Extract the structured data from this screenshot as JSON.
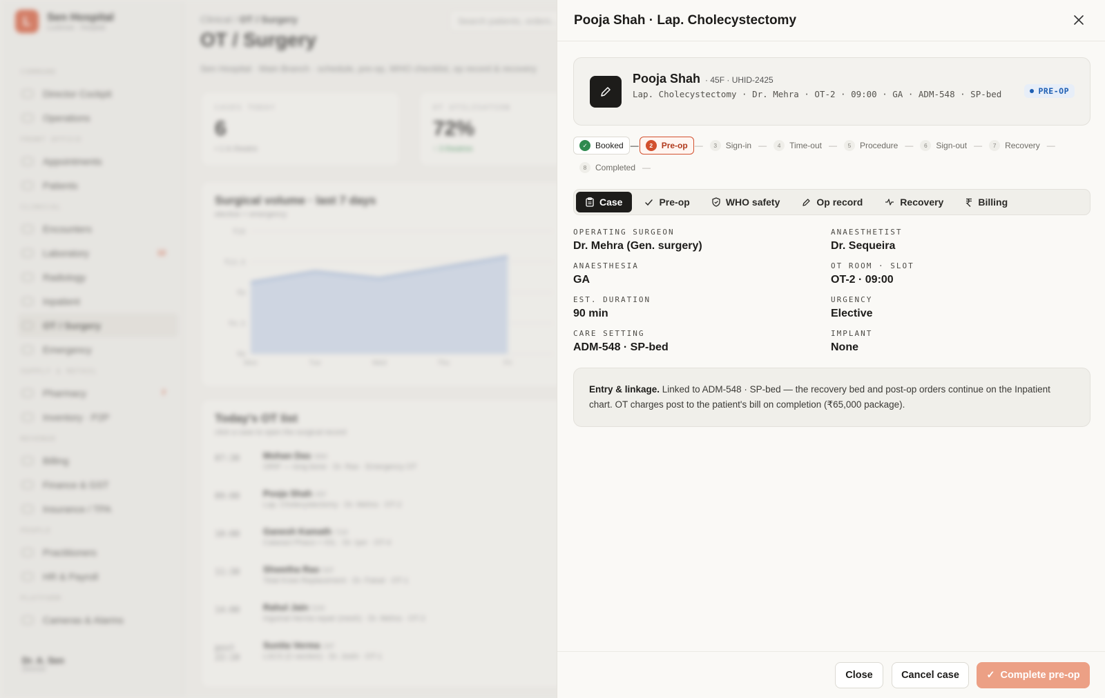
{
  "background": {
    "brand": {
      "name": "Sen Hospital",
      "sub": "Lucknow · Hospital"
    },
    "nav": [
      {
        "section": "COMMAND",
        "items": [
          {
            "label": "Director Cockpit"
          },
          {
            "label": "Operations"
          }
        ]
      },
      {
        "section": "FRONT OFFICE",
        "items": [
          {
            "label": "Appointments"
          },
          {
            "label": "Patients"
          }
        ]
      },
      {
        "section": "CLINICAL",
        "items": [
          {
            "label": "Encounters"
          },
          {
            "label": "Laboratory",
            "badge": "12"
          },
          {
            "label": "Radiology"
          },
          {
            "label": "Inpatient"
          },
          {
            "label": "OT / Surgery",
            "active": true
          },
          {
            "label": "Emergency"
          }
        ]
      },
      {
        "section": "SUPPLY & RETAIL",
        "items": [
          {
            "label": "Pharmacy",
            "badge": "7"
          },
          {
            "label": "Inventory · P2P"
          }
        ]
      },
      {
        "section": "REVENUE",
        "items": [
          {
            "label": "Billing"
          },
          {
            "label": "Finance & GST"
          },
          {
            "label": "Insurance / TPA"
          }
        ]
      },
      {
        "section": "PEOPLE",
        "items": [
          {
            "label": "Practitioners"
          },
          {
            "label": "HR & Payroll"
          }
        ]
      },
      {
        "section": "PLATFORM",
        "items": [
          {
            "label": "Cameras & Alarms"
          }
        ]
      }
    ],
    "user": {
      "name": "Dr. A. Sen",
      "role": "Director"
    },
    "breadcrumb": {
      "prefix": "Clinical / ",
      "current": "OT / Surgery"
    },
    "search_placeholder": "Search patients, orders…",
    "page_title": "OT / Surgery",
    "page_subtitle": "Sen Hospital · Main Branch · schedule, pre-op, WHO checklist, op record & recovery",
    "kpis": [
      {
        "label": "CASES TODAY",
        "value": "6",
        "sub": "• 1 in theatre"
      },
      {
        "label": "OT UTILISATION",
        "value": "72%",
        "sub": "↑ 3 theatres"
      }
    ],
    "chart_card": {
      "title": "Surgical volume · last 7 days",
      "subtitle": "elective + emergency"
    },
    "chart_data": {
      "type": "area",
      "categories": [
        "Mon",
        "Tue",
        "Wed",
        "Thu",
        "Fri"
      ],
      "values": [
        10.5,
        12.1,
        11.1,
        12.7,
        14.3
      ],
      "ylim": [
        0,
        18
      ],
      "yticks": [
        "₹18",
        "₹13.5",
        "₹9",
        "₹4.5",
        "₹0"
      ],
      "grid": true
    },
    "ot_list": {
      "title": "Today's OT list",
      "subtitle": "click a case to open the surgical record",
      "rows": [
        {
          "time": "07:30",
          "name": "Mohan Das",
          "meta": "58M",
          "proc": "ORIF — long bone · Dr. Rao · Emergency OT"
        },
        {
          "time": "09:00",
          "name": "Pooja Shah",
          "meta": "45F",
          "proc": "Lap. Cholecystectomy · Dr. Mehra · OT-2"
        },
        {
          "time": "10:00",
          "name": "Ganesh Kamath",
          "meta": "71M",
          "proc": "Cataract Phaco + IOL · Dr. Iyer · OT-4"
        },
        {
          "time": "11:30",
          "name": "Shwetha Rao",
          "meta": "60F",
          "proc": "Total Knee Replacement · Dr. Faisal · OT-1"
        },
        {
          "time": "14:00",
          "name": "Rahul Jain",
          "meta": "52M",
          "proc": "Inguinal Hernia repair (mesh) · Dr. Mehra · OT-2"
        },
        {
          "time": "post 22:10",
          "name": "Sunita Verma",
          "meta": "34F",
          "proc": "LSCS (C-section) · Dr. Joshi · OT-1"
        }
      ]
    }
  },
  "drawer": {
    "title": "Pooja Shah · Lap. Cholecystectomy",
    "patient": {
      "name": "Pooja Shah",
      "meta": "· 45F · UHID-2425",
      "line": "Lap. Cholecystectomy · Dr. Mehra · OT-2 · 09:00 · GA · ADM-548 · SP-bed",
      "badge": "PRE-OP",
      "badge_color": "#1e5fb3"
    },
    "steps": [
      {
        "num": "✓",
        "label": "Booked",
        "state": "done"
      },
      {
        "num": "2",
        "label": "Pre-op",
        "state": "current"
      },
      {
        "num": "3",
        "label": "Sign-in",
        "state": "todo"
      },
      {
        "num": "4",
        "label": "Time-out",
        "state": "todo"
      },
      {
        "num": "5",
        "label": "Procedure",
        "state": "todo"
      },
      {
        "num": "6",
        "label": "Sign-out",
        "state": "todo"
      },
      {
        "num": "7",
        "label": "Recovery",
        "state": "todo"
      },
      {
        "num": "8",
        "label": "Completed",
        "state": "todo"
      }
    ],
    "tabs": [
      {
        "label": "Case",
        "icon": "clipboard-icon",
        "active": true
      },
      {
        "label": "Pre-op",
        "icon": "check-icon"
      },
      {
        "label": "WHO safety",
        "icon": "shield-icon"
      },
      {
        "label": "Op record",
        "icon": "pencil-icon"
      },
      {
        "label": "Recovery",
        "icon": "pulse-icon"
      },
      {
        "label": "Billing",
        "icon": "rupee-icon"
      }
    ],
    "fields": {
      "operating_surgeon": {
        "label": "OPERATING SURGEON",
        "value": "Dr. Mehra (Gen. surgery)"
      },
      "anaesthetist": {
        "label": "ANAESTHETIST",
        "value": "Dr. Sequeira"
      },
      "anaesthesia": {
        "label": "ANAESTHESIA",
        "value": "GA"
      },
      "ot_room_slot": {
        "label": "OT ROOM · SLOT",
        "value": "OT-2 · 09:00"
      },
      "est_duration": {
        "label": "EST. DURATION",
        "value": "90 min"
      },
      "urgency": {
        "label": "URGENCY",
        "value": "Elective"
      },
      "care_setting": {
        "label": "CARE SETTING",
        "value": "ADM-548 · SP-bed"
      },
      "implant": {
        "label": "IMPLANT",
        "value": "None"
      }
    },
    "note": {
      "lead": "Entry & linkage.",
      "text": " Linked to ADM-548 · SP-bed — the recovery bed and post-op orders continue on the Inpatient chart. OT charges post to the patient's bill on completion (₹65,000 package)."
    },
    "footer": {
      "close": "Close",
      "cancel": "Cancel case",
      "primary": "Complete pre-op"
    },
    "colors": {
      "accent": "#d2502e",
      "primary_button": "#eca085",
      "done": "#2f8a4e"
    }
  }
}
